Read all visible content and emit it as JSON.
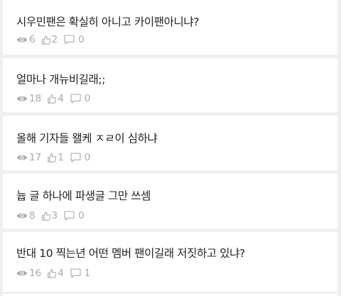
{
  "posts": [
    {
      "title": "시우민팬은 확실히 아니고 카이팬아니냐?",
      "views": "6",
      "likes": "2",
      "comments": "0"
    },
    {
      "title": "얼마나 개뉴비길래;;",
      "views": "18",
      "likes": "4",
      "comments": "0"
    },
    {
      "title": "올해 기자들 왤케 ㅈㄹ이 심하냐",
      "views": "17",
      "likes": "1",
      "comments": "0"
    },
    {
      "title": "늅 글 하나에 파생글 그만 쓰셈",
      "views": "8",
      "likes": "3",
      "comments": "0"
    },
    {
      "title": "반대 10 찍는년 어떤 멤버 팬이길래 저짓하고 있냐?",
      "views": "16",
      "likes": "4",
      "comments": "1"
    }
  ],
  "icons": {
    "views": "eye-icon",
    "likes": "thumbs-up-icon",
    "comments": "comment-icon"
  },
  "colors": {
    "background": "#efefef",
    "card": "#ffffff",
    "title": "#222222",
    "meta": "#a9a9a9"
  }
}
